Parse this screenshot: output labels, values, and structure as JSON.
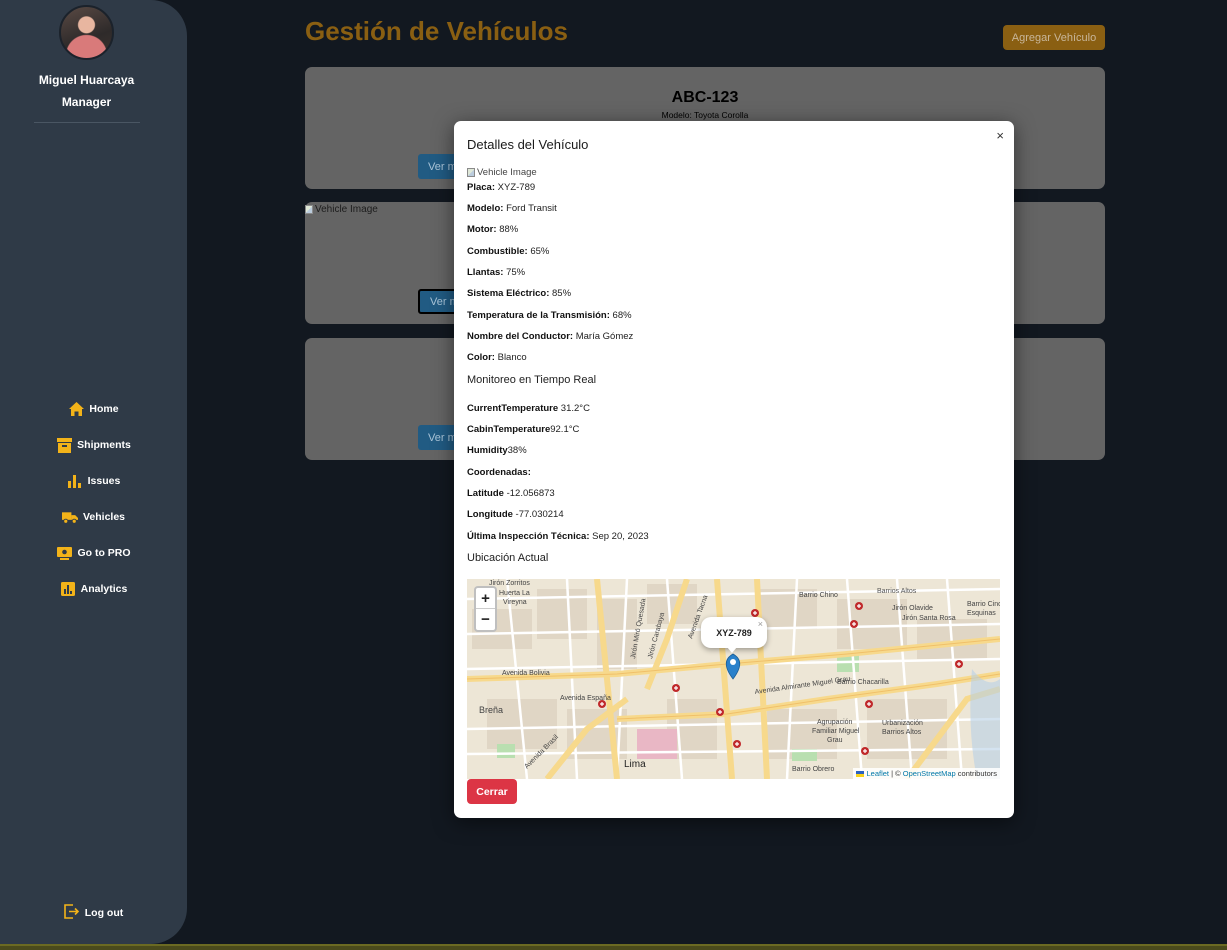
{
  "sidebar": {
    "user_name": "Miguel Huarcaya",
    "user_role": "Manager",
    "items": [
      {
        "label": "Home",
        "icon": "home-icon"
      },
      {
        "label": "Shipments",
        "icon": "box-icon"
      },
      {
        "label": "Issues",
        "icon": "bar-chart-icon"
      },
      {
        "label": "Vehicles",
        "icon": "truck-icon"
      },
      {
        "label": "Go to PRO",
        "icon": "pro-icon"
      },
      {
        "label": "Analytics",
        "icon": "analytics-icon"
      }
    ],
    "logout_label": "Log out"
  },
  "header": {
    "title": "Gestión de Vehículos",
    "add_button": "Agregar Vehículo"
  },
  "cards": [
    {
      "plate": "ABC-123",
      "model": "Modelo: Toyota Corolla",
      "more_button": "Ver más"
    },
    {
      "image_alt": "Vehicle Image",
      "more_button": "Ver más"
    },
    {
      "more_button": "Ver más"
    }
  ],
  "modal": {
    "title": "Detalles del Vehículo",
    "close_glyph": "×",
    "image_alt": "Vehicle Image",
    "fields": [
      {
        "label": "Placa:",
        "value": "XYZ-789"
      },
      {
        "label": "Modelo:",
        "value": "Ford Transit"
      },
      {
        "label": "Motor:",
        "value": "88%"
      },
      {
        "label": "Combustible:",
        "value": "65%"
      },
      {
        "label": "Llantas:",
        "value": "75%"
      },
      {
        "label": "Sistema Eléctrico:",
        "value": "85%"
      },
      {
        "label": "Temperatura de la Transmisión:",
        "value": "68%"
      },
      {
        "label": "Nombre del Conductor:",
        "value": "María Gómez"
      },
      {
        "label": "Color:",
        "value": "Blanco"
      }
    ],
    "monitoring_title": "Monitoreo en Tiempo Real",
    "monitoring": [
      {
        "label": "CurrentTemperature",
        "value": "31.2°C"
      },
      {
        "label": "CabinTemperature",
        "value": "92.1°C"
      },
      {
        "label": "Humidity",
        "value": "38%"
      },
      {
        "label": "Coordenadas:",
        "value": ""
      },
      {
        "label": "Latitude",
        "value": "-12.056873"
      },
      {
        "label": "Longitude",
        "value": "-77.030214"
      },
      {
        "label": "Última Inspección Técnica:",
        "value": "Sep 20, 2023"
      }
    ],
    "location_title": "Ubicación Actual",
    "map": {
      "zoom_in": "+",
      "zoom_out": "−",
      "popup_label": "XYZ-789",
      "popup_close": "×",
      "attribution_leaflet": "Leaflet",
      "attribution_sep": " | © ",
      "attribution_osm": "OpenStreetMap",
      "attribution_tail": " contributors",
      "place_labels": [
        "Jirón Zorritos",
        "Huerta La Vireyna",
        "Avenida Bolivia",
        "Avenida España",
        "Breña",
        "Lima",
        "Barrio Chino",
        "Barrios Altos",
        "Jirón Olavide",
        "Jirón Santa Rosa",
        "Avenida Almirante Miguel Grau",
        "Agrupación Familiar Miguel Grau",
        "Urbanización Barrios Altos",
        "Barrio Obrero",
        "Jirón Miró Quesada",
        "Jirón Carabaya",
        "Avenida Tacna",
        "Avenida Brasil",
        "Esquinas"
      ]
    },
    "close_button": "Cerrar"
  },
  "colors": {
    "accent": "#8a5f12",
    "sidebar": "#2f3a47",
    "danger": "#dc3545",
    "link": "#0078a8",
    "marker": "#2a81cb"
  }
}
